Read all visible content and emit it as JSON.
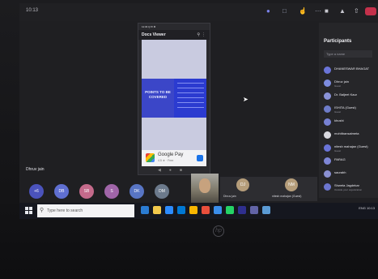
{
  "call": {
    "time": "10:13"
  },
  "top_icons": [
    "people-icon",
    "chat-icon",
    "raise-hand-icon",
    "more-icon"
  ],
  "controls": [
    "camera-icon",
    "mic-icon",
    "share-icon",
    "hangup-icon"
  ],
  "shared_screen": {
    "status": "11:34 Q ✉ ⚙",
    "app_title": "Docs Viewer",
    "slide_text": "POINTS TO BE COVERED",
    "ad": {
      "name": "Google Pay",
      "sub": "4.5 ★ · Free"
    }
  },
  "participants": {
    "title": "Participants",
    "search_placeholder": "Type a name",
    "list": [
      {
        "name": "DHANESWAR BHAGAT",
        "sub": "",
        "color": "#6a74d8"
      },
      {
        "name": "Dhruv jain",
        "sub": "Guest",
        "color": "#7d8ce0"
      },
      {
        "name": "Dr. Baljeet Kaur",
        "sub": "",
        "color": "#8a93d8"
      },
      {
        "name": "ISHITA (Guest)",
        "sub": "Guest",
        "color": "#6e7cc9"
      },
      {
        "name": "khushi",
        "sub": "",
        "color": "#7781d4"
      },
      {
        "name": "mohitbansalmeta",
        "sub": "",
        "color": "#d9d9e0"
      },
      {
        "name": "nitesh mahajan (Guest)",
        "sub": "Guest",
        "color": "#6a74d8"
      },
      {
        "name": "PARAG",
        "sub": "",
        "color": "#7e86d6"
      },
      {
        "name": "saurabh",
        "sub": "",
        "color": "#8a90d2"
      },
      {
        "name": "Shweta Jagdekar",
        "sub": "Outside your organization",
        "color": "#6c76cf"
      }
    ]
  },
  "stage": {
    "presenter": "Dhruv jain",
    "avatars": [
      {
        "initials": "+6",
        "color": "#4b53bc"
      },
      {
        "initials": "DB",
        "color": "#5f6fd1"
      },
      {
        "initials": "SB",
        "color": "#c46a8b"
      },
      {
        "initials": "S",
        "color": "#a065a8"
      },
      {
        "initials": "DK",
        "color": "#5875c4"
      },
      {
        "initials": "DM",
        "color": "#6c7a8c"
      }
    ],
    "cards": [
      {
        "initials": "DJ",
        "name": "Dhruv jain"
      },
      {
        "initials": "NM",
        "name": "nitesh mahajan (Guest)"
      }
    ]
  },
  "taskbar": {
    "search_placeholder": "Type here to search",
    "icons": [
      "#2b7cd3",
      "#f2c94c",
      "#2d8cff",
      "#0078d4",
      "#f7b500",
      "#e94f3c",
      "#3b8eea",
      "#25d366",
      "#2f2f8f",
      "#6264a7",
      "#5b9bd5"
    ],
    "tray": "ENG 10:13"
  },
  "brand": {
    "logo": "hp"
  }
}
